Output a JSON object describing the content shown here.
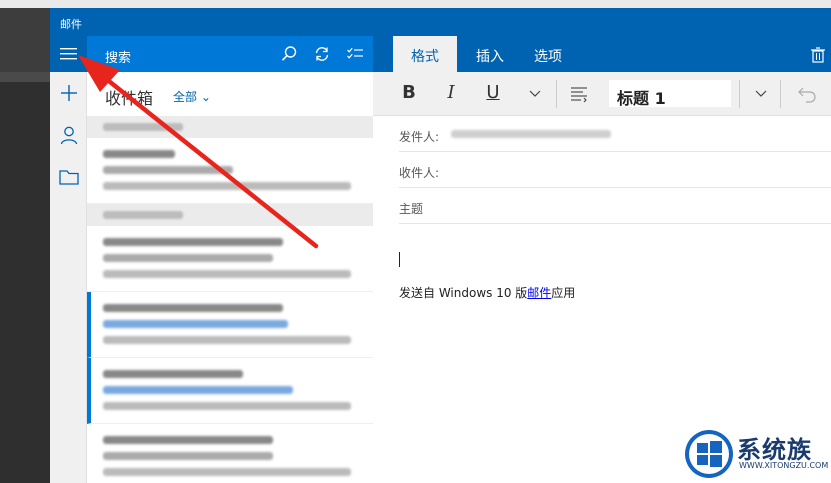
{
  "app": {
    "title": "邮件"
  },
  "header": {
    "search_label": "搜索",
    "icons": [
      "search-icon",
      "sync-icon",
      "select-icon"
    ]
  },
  "folder": {
    "name": "收件箱",
    "filter": "全部"
  },
  "reading_tabs": [
    {
      "label": "格式",
      "active": true
    },
    {
      "label": "插入",
      "active": false
    },
    {
      "label": "选项",
      "active": false
    }
  ],
  "format": {
    "bold": "B",
    "italic": "I",
    "underline": "U",
    "style_value": "标题 1"
  },
  "compose": {
    "from_label": "发件人:",
    "to_label": "收件人:",
    "subject_label": "主题",
    "signature_prefix": "发送自 Windows 10 版",
    "signature_link": "邮件",
    "signature_suffix": "应用"
  },
  "watermark": {
    "text": "系统族",
    "sub": "WWW.XITONGZU.COM"
  },
  "colors": {
    "accent": "#0063b1",
    "header": "#0078d7",
    "arrow": "#e8251c"
  }
}
